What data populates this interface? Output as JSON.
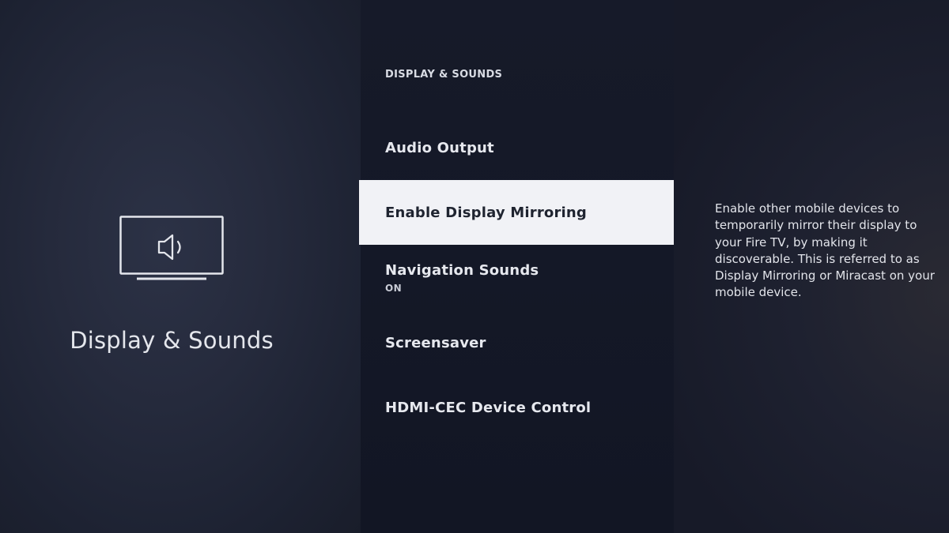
{
  "section": {
    "title": "Display & Sounds",
    "icon": "tv-speaker-icon"
  },
  "menu": {
    "header": "DISPLAY & SOUNDS",
    "items": [
      {
        "label": "Audio Output",
        "sublabel": ""
      },
      {
        "label": "Enable Display Mirroring",
        "sublabel": ""
      },
      {
        "label": "Navigation Sounds",
        "sublabel": "ON"
      },
      {
        "label": "Screensaver",
        "sublabel": ""
      },
      {
        "label": "HDMI-CEC Device Control",
        "sublabel": ""
      }
    ],
    "selected_index": 1
  },
  "description": {
    "text": "Enable other mobile devices to temporarily mirror their display to your Fire TV, by making it discoverable. This is referred to as Display Mirroring or Miracast on your mobile device."
  },
  "colors": {
    "selected_background": "#f1f2f6",
    "selected_text": "#1f2430",
    "text": "#e6e8ee"
  }
}
